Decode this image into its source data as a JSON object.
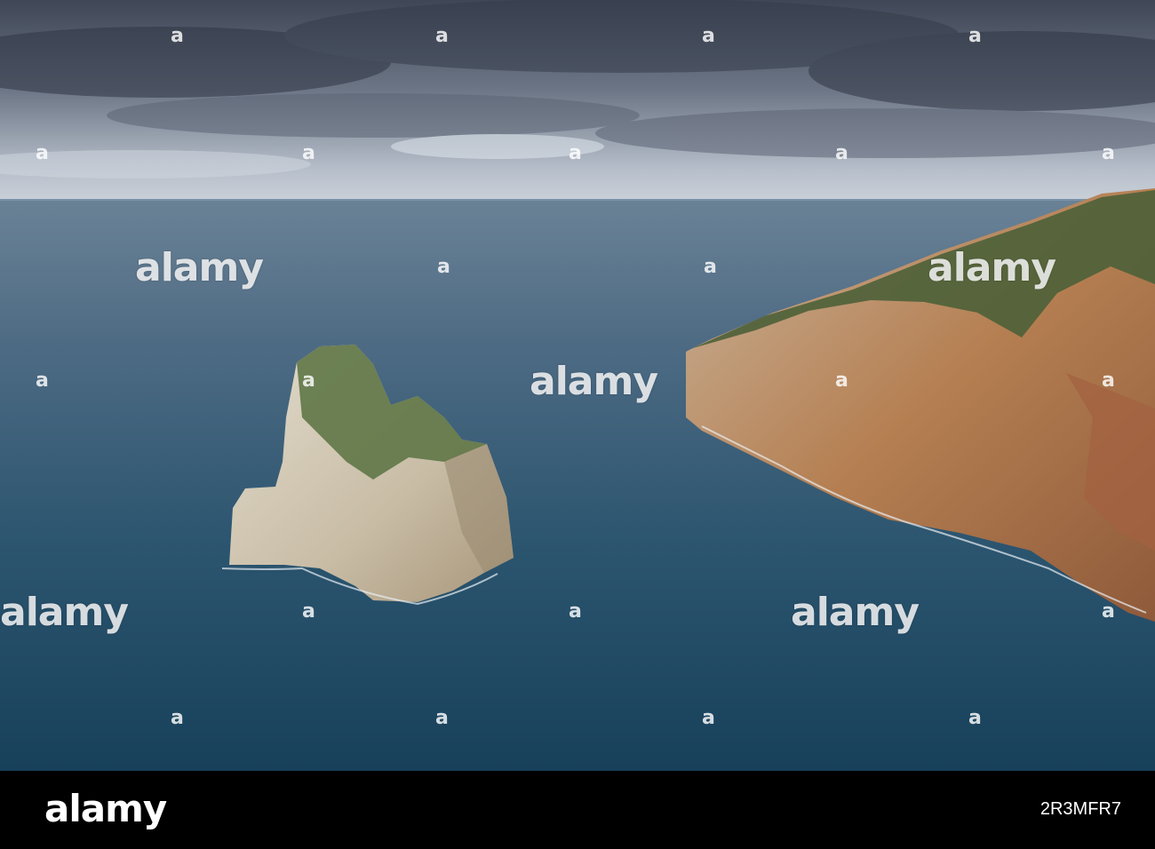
{
  "watermark": {
    "text": "alamy",
    "mark": "a"
  },
  "footer": {
    "logo": "alamy",
    "image_id": "2R3MFR7"
  },
  "colors": {
    "sky_dark": "#4f5766",
    "sky_light": "#c7ced8",
    "sea_far": "#5a7590",
    "sea_near": "#1b4660",
    "rock_light": "#d8d2c4",
    "cliff_orange": "#b98a5e",
    "vegetation": "#5c7040"
  }
}
